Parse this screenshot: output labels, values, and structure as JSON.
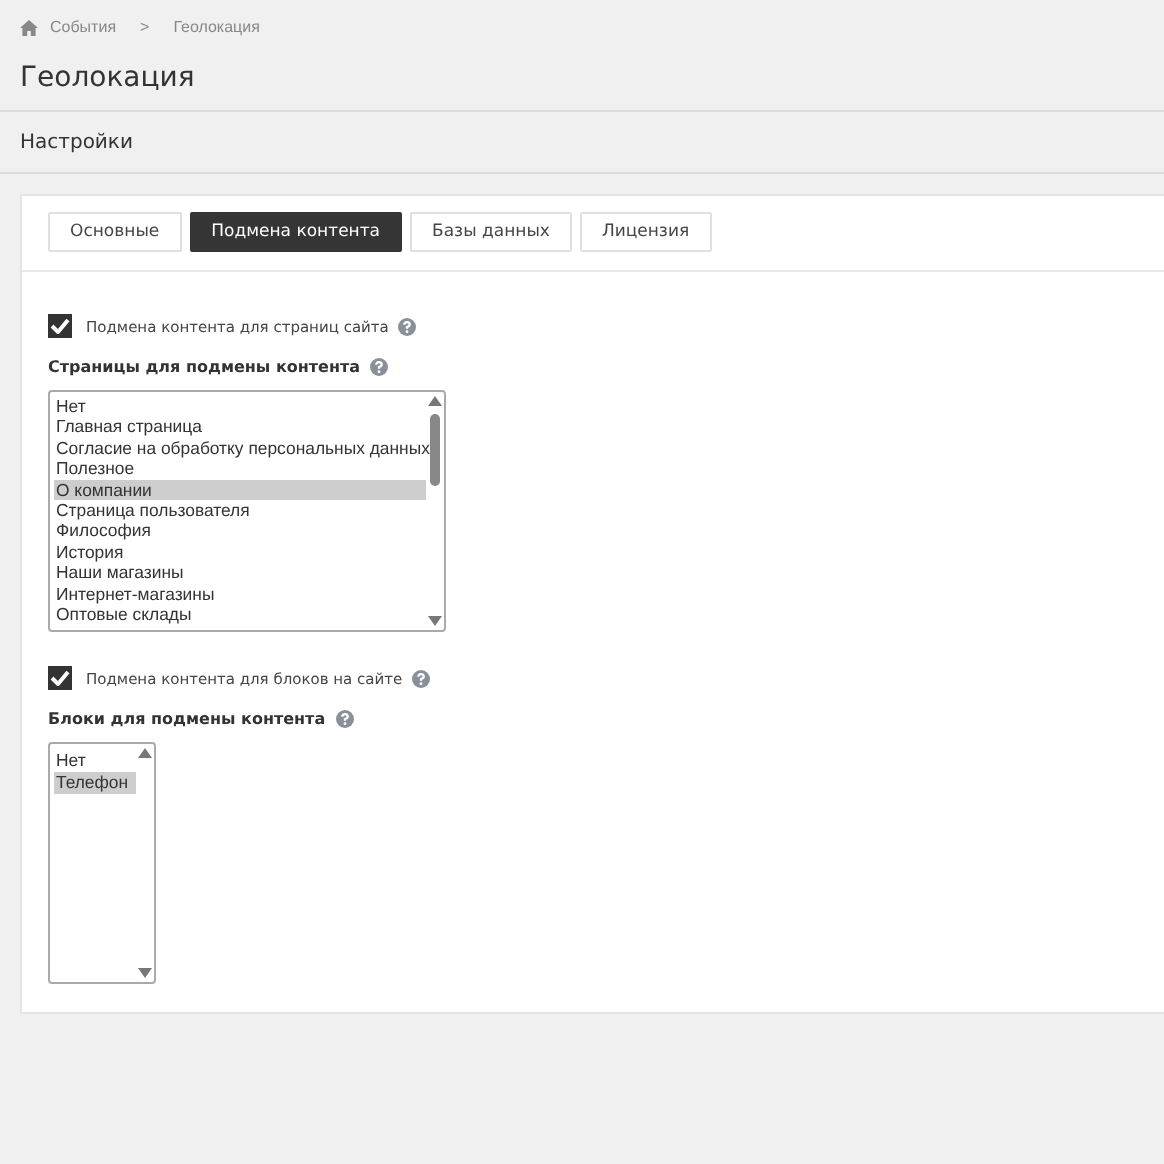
{
  "breadcrumbs": [
    {
      "label": "События"
    },
    {
      "label": "Геолокация"
    }
  ],
  "breadcrumb_separator": ">",
  "title": "Геолокация",
  "section_title": "Настройки",
  "tabs": [
    {
      "label": "Основные",
      "selected": false
    },
    {
      "label": "Подмена контента",
      "selected": true
    },
    {
      "label": "Базы данных",
      "selected": false
    },
    {
      "label": "Лицензия",
      "selected": false
    }
  ],
  "groups": [
    {
      "checkbox": {
        "label": "Подмена контента для страниц сайта",
        "checked": true
      },
      "list_label": "Страницы для подмены контента",
      "list": {
        "wide": true,
        "items": [
          {
            "label": "Нет",
            "selected": false
          },
          {
            "label": "Главная страница",
            "selected": false
          },
          {
            "label": "Согласие на обработку персональных данных",
            "selected": false
          },
          {
            "label": "Полезное",
            "selected": false
          },
          {
            "label": "О компании",
            "selected": true
          },
          {
            "label": "Страница пользователя",
            "selected": false
          },
          {
            "label": "Философия",
            "selected": false
          },
          {
            "label": "История",
            "selected": false
          },
          {
            "label": "Наши магазины",
            "selected": false
          },
          {
            "label": "Интернет-магазины",
            "selected": false
          },
          {
            "label": "Оптовые склады",
            "selected": false
          }
        ]
      }
    },
    {
      "checkbox": {
        "label": "Подмена контента для блоков на сайте",
        "checked": true
      },
      "list_label": "Блоки для подмены контента",
      "list": {
        "wide": false,
        "items": [
          {
            "label": "Нет",
            "selected": false
          },
          {
            "label": "Телефон",
            "selected": true
          }
        ]
      }
    }
  ]
}
